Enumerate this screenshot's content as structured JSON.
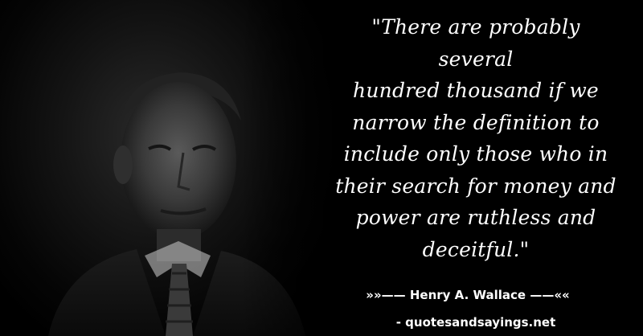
{
  "quote": {
    "lines": [
      "\"There are probably several",
      "hundred thousand if we",
      "narrow the definition to",
      "include only those who in",
      "their search for money and",
      "power are ruthless and",
      "deceitful.\""
    ]
  },
  "author": {
    "label": "»»—— Henry A. Wallace ——««"
  },
  "source": {
    "label": "- quotesandsayings.net"
  },
  "colors": {
    "background": "#000000",
    "text": "#ffffff"
  }
}
